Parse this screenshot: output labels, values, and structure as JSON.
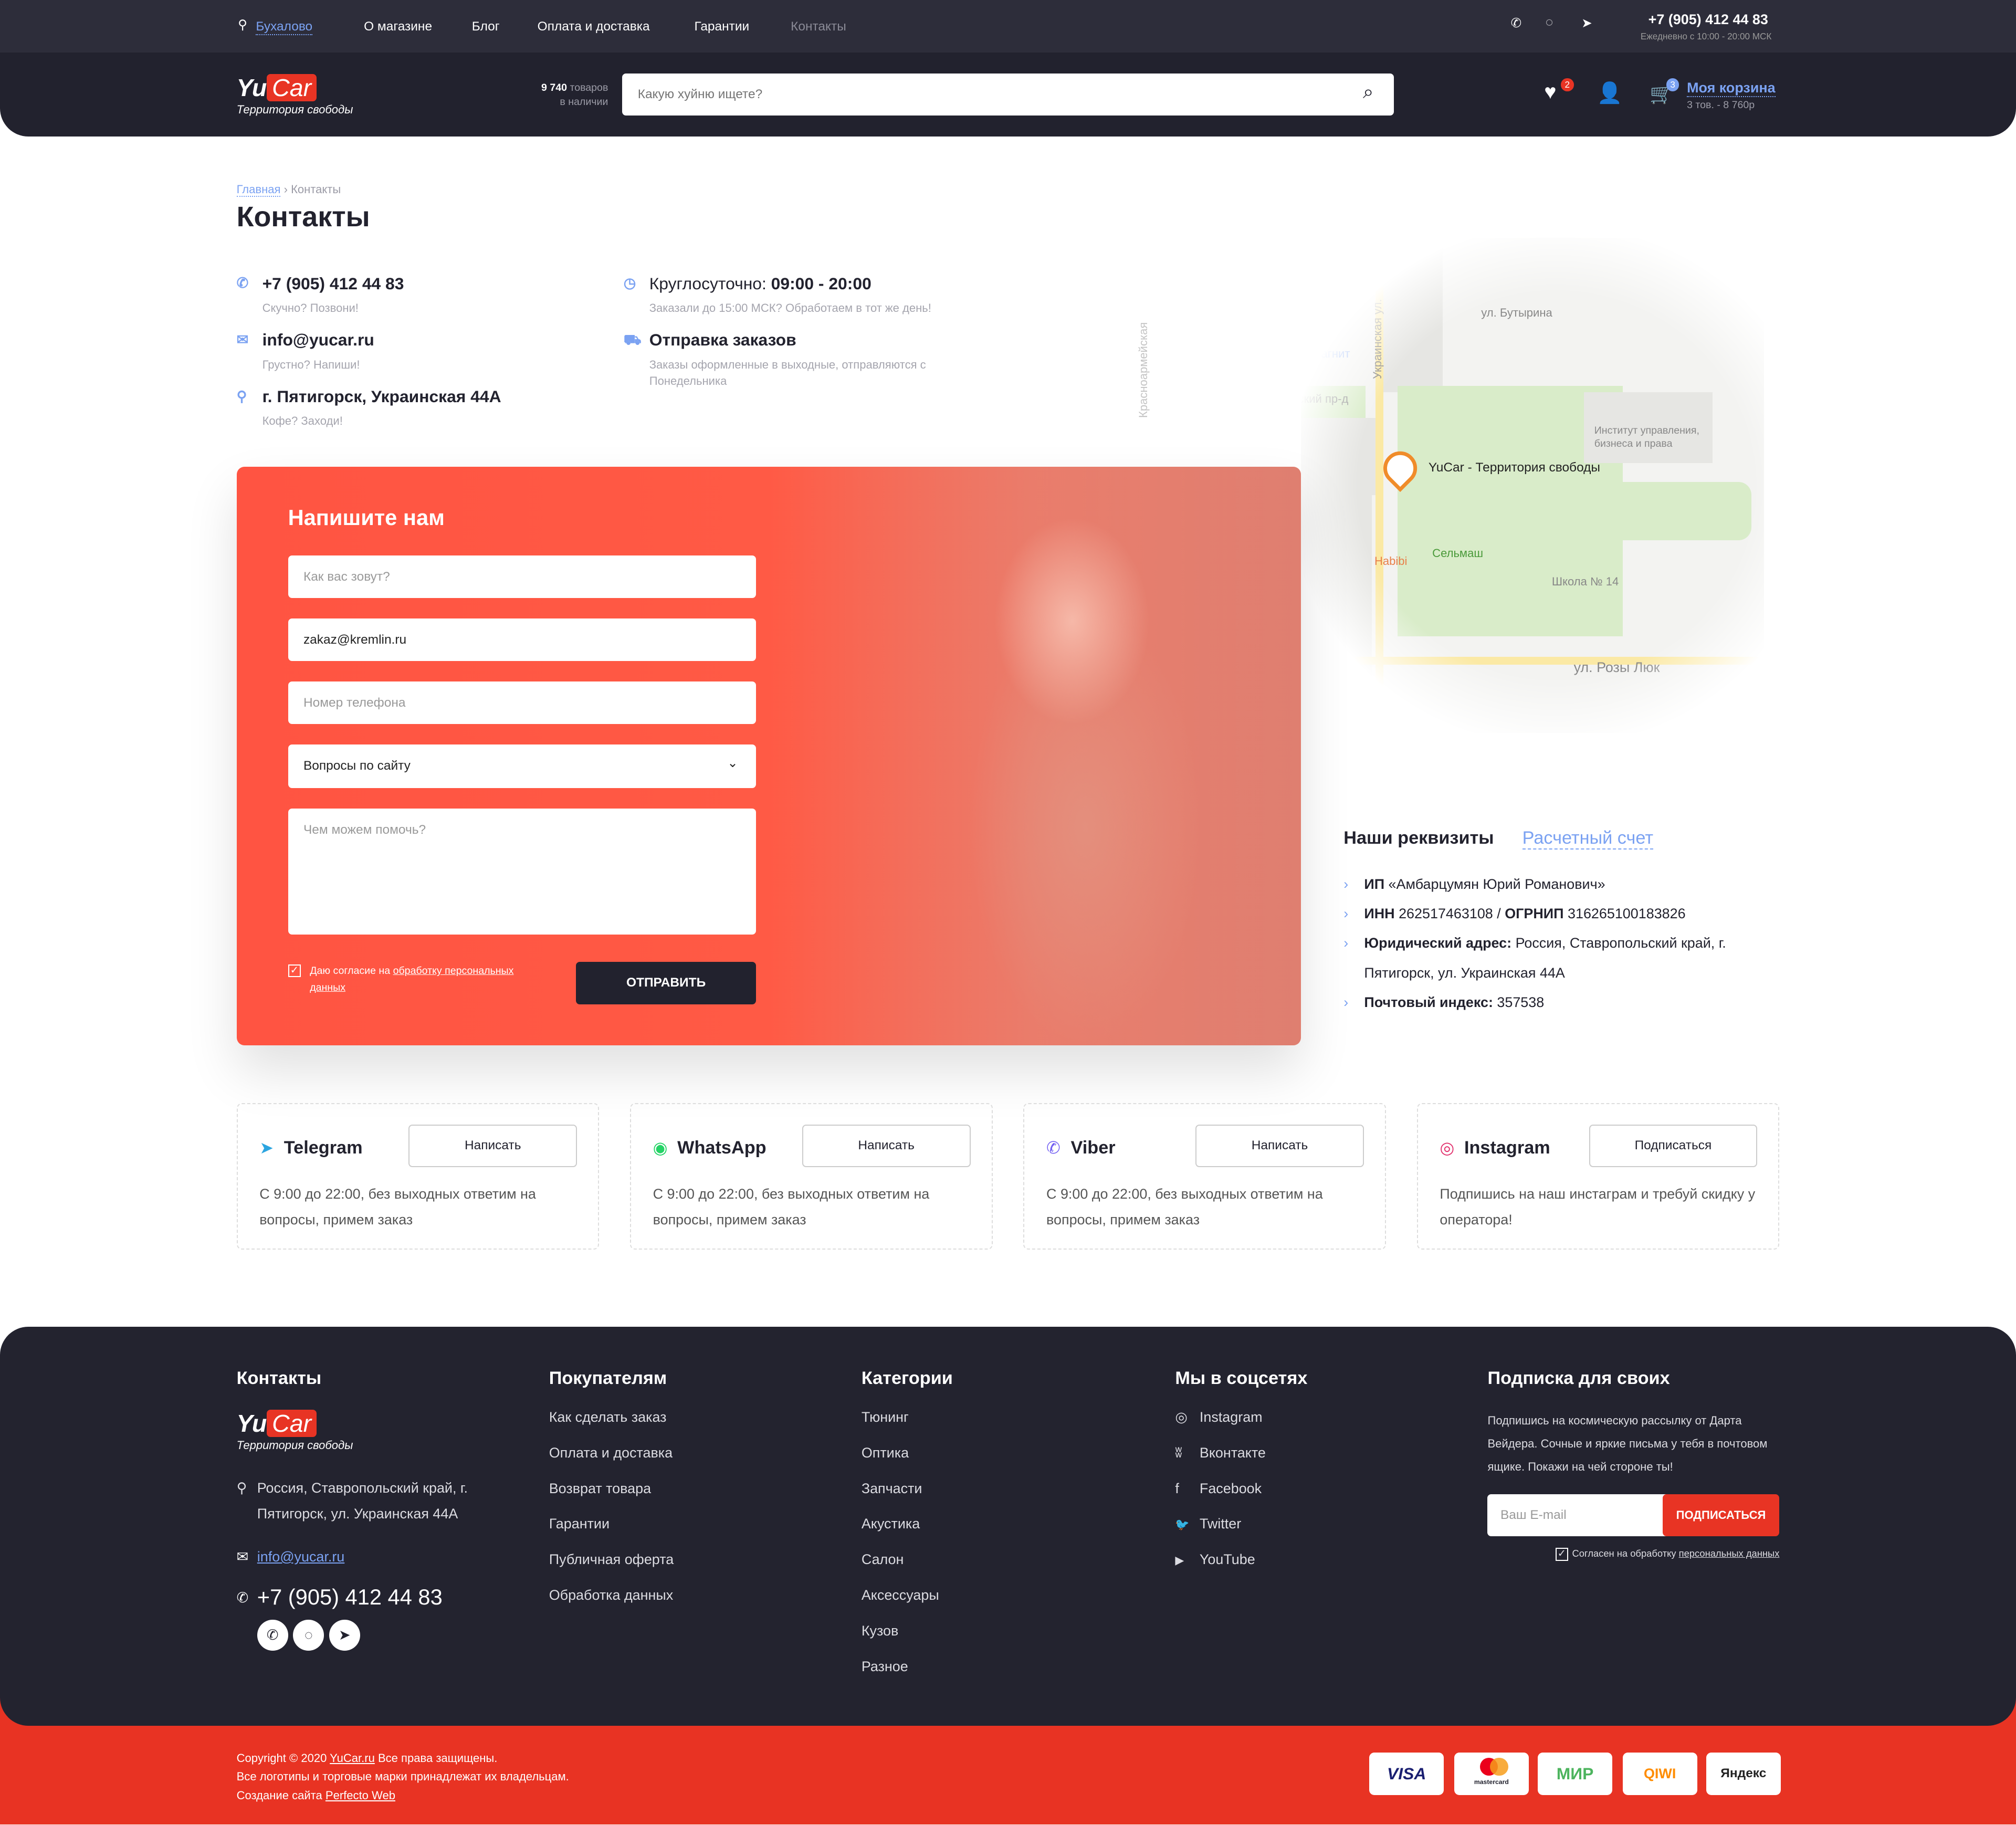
{
  "topbar": {
    "city": "Бухалово",
    "nav": [
      "О магазине",
      "Блог",
      "Оплата и доставка",
      "Гарантии",
      "Контакты"
    ],
    "phone": "+7 (905) 412 44 83",
    "hours": "Ежедневно с 10:00 - 20:00 МСК"
  },
  "header": {
    "logo_yu": "Yu",
    "logo_car": "Car",
    "logo_tagline": "Территория свободы",
    "stock_count": "9 740",
    "stock_word": "товаров",
    "stock_sub": "в наличии",
    "search_placeholder": "Какую хуйню ищете?",
    "wishlist_count": "2",
    "cart_count": "3",
    "cart_label": "Моя корзина",
    "cart_summary": "3 тов. - 8 760р"
  },
  "breadcrumb": {
    "home": "Главная",
    "current": "Контакты"
  },
  "page_title": "Контакты",
  "contacts": [
    {
      "title": "+7 (905) 412 44 83",
      "sub": "Скучно? Позвони!"
    },
    {
      "title": "info@yucar.ru",
      "sub": "Грустно? Напиши!"
    },
    {
      "title": "г. Пятигорск, Украинская 44А",
      "sub": "Кофе? Заходи!"
    }
  ],
  "hours": {
    "prefix": "Круглосуточно: ",
    "time": "09:00 - 20:00",
    "sub": "Заказали до 15:00 МСК? Обработаем в тот же день!"
  },
  "shipping": {
    "title": "Отправка заказов",
    "sub": "Заказы оформленные в выходные, отправляются с Понедельника"
  },
  "map": {
    "marker_label": "YuCar - Территория свободы",
    "labels": [
      "ул. Бутырина",
      "Майский пр-д",
      "Украинская ул.",
      "Магнит",
      "Сельмаш",
      "Habibi",
      "Школа № 14",
      "ул. Розы Люк",
      "Красноармейская",
      "Институт управления, бизнеса и права"
    ]
  },
  "form": {
    "title": "Напишите нам",
    "name_placeholder": "Как вас зовут?",
    "email_value": "zakaz@kremlin.ru",
    "phone_placeholder": "Номер телефона",
    "topic_value": "Вопросы по сайту",
    "message_placeholder": "Чем можем помочь?",
    "consent_prefix": "Даю согласие на ",
    "consent_link": "обработку персональных данных",
    "submit": "ОТПРАВИТЬ",
    "consent_checked": true
  },
  "requisites": {
    "tab_active": "Наши реквизиты",
    "tab_other": "Расчетный счет",
    "items": [
      {
        "bold": "ИП",
        "text": " «Амбарцумян Юрий Романович»"
      },
      {
        "bold": "ИНН",
        "text": " 262517463108 / ",
        "bold2": "ОГРНИП",
        "text2": " 316265100183826"
      },
      {
        "bold": "Юридический адрес:",
        "text": " Россия, Ставропольский край, г. Пятигорск, ул. Украинская 44А"
      },
      {
        "bold": "Почтовый индекс:",
        "text": " 357538"
      }
    ]
  },
  "messengers": [
    {
      "name": "Telegram",
      "icon": "telegram-icon",
      "button": "Написать",
      "desc": "С 9:00 до 22:00, без выходных ответим на вопросы, примем заказ",
      "color": "#2ca5e0"
    },
    {
      "name": "WhatsApp",
      "icon": "whatsapp-icon",
      "button": "Написать",
      "desc": "С 9:00 до 22:00, без выходных ответим на вопросы, примем заказ",
      "color": "#25d366"
    },
    {
      "name": "Viber",
      "icon": "viber-icon",
      "button": "Написать",
      "desc": "С 9:00 до 22:00, без выходных ответим на вопросы, примем заказ",
      "color": "#7360f2"
    },
    {
      "name": "Instagram",
      "icon": "instagram-icon",
      "button": "Подписаться",
      "desc": "Подпишись на наш инстаграм и требуй скидку у оператора!",
      "color": "#e1306c"
    }
  ],
  "footer": {
    "contacts_title": "Контакты",
    "address": "Россия, Ставропольский край, г. Пятигорск, ул. Украинская 44А",
    "email": "info@yucar.ru",
    "phone": "+7 (905) 412 44 83",
    "buyers_title": "Покупателям",
    "buyers": [
      "Как сделать заказ",
      "Оплата и доставка",
      "Возврат товара",
      "Гарантии",
      "Публичная оферта",
      "Обработка данных"
    ],
    "categories_title": "Категории",
    "categories": [
      "Тюнинг",
      "Оптика",
      "Запчасти",
      "Акустика",
      "Салон",
      "Аксессуары",
      "Кузов",
      "Разное"
    ],
    "social_title": "Мы в соцсетях",
    "social": [
      {
        "label": "Instagram",
        "icon": "◎"
      },
      {
        "label": "Вконтакте",
        "icon": "ʬ"
      },
      {
        "label": "Facebook",
        "icon": "f"
      },
      {
        "label": "Twitter",
        "icon": "🐦"
      },
      {
        "label": "YouTube",
        "icon": "▶"
      }
    ],
    "subscribe_title": "Подписка для своих",
    "subscribe_text": "Подпишись на космическую рассылку от Дарта Вейдера. Сочные и яркие письма у тебя в почтовом ящике. Покажи на чей стороне ты!",
    "email_placeholder": "Ваш E-mail",
    "subscribe_button": "ПОДПИСАТЬСЯ",
    "agree_prefix": "Согласен на обработку ",
    "agree_link": "персональных данных"
  },
  "bottom": {
    "copy_prefix": "Copyright © 2020 ",
    "copy_link": "YuCar.ru",
    "copy_suffix": " Все права защищены.",
    "trademarks": "Все логотипы и торговые марки принадлежат их владельцам.",
    "made_prefix": "Создание сайта ",
    "made_link": "Perfecto Web",
    "payments": [
      "VISA",
      "mastercard",
      "МИР",
      "QIWI",
      "Яндекс"
    ]
  },
  "colors": {
    "accent_red": "#e83424",
    "link_blue": "#7ba2f2",
    "dark": "#22222e"
  }
}
